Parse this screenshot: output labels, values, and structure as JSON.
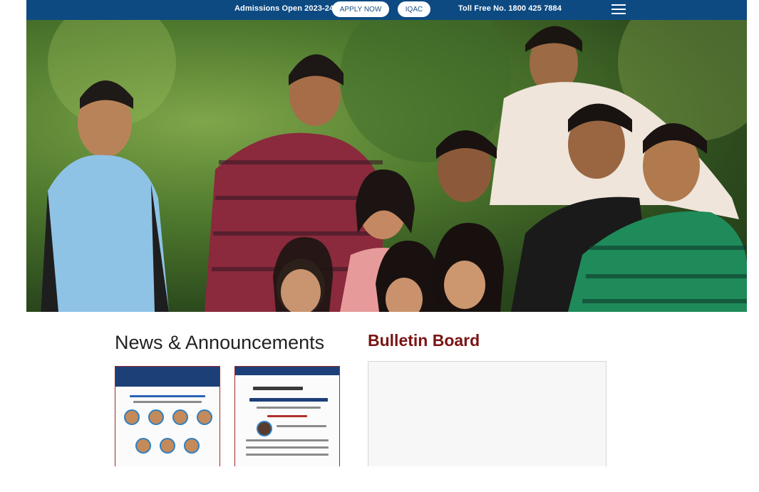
{
  "topbar": {
    "admissions_text": "Admissions Open 2023-24",
    "apply_label": "APPLY NOW",
    "iqac_label": "IQAC",
    "tollfree_text": "Toll Free No. 1800 425 7884",
    "bg_color": "#0d4a82"
  },
  "hero": {
    "alt": "Group of smiling students"
  },
  "news": {
    "title": "News & Announcements"
  },
  "bulletin": {
    "title": "Bulletin Board",
    "title_color": "#7a1414"
  },
  "cards": [
    {
      "name": "news-poster-researchers",
      "accent": "#1c3f78"
    },
    {
      "name": "news-poster-inauguration",
      "accent": "#1c3f78"
    }
  ]
}
